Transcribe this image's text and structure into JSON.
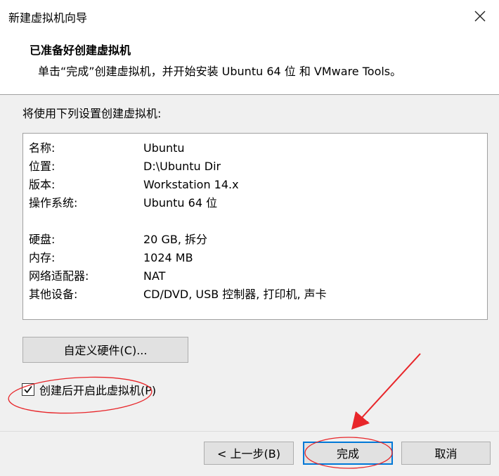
{
  "window": {
    "title": "新建虚拟机向导",
    "close_icon": "close-icon"
  },
  "header": {
    "title": "已准备好创建虚拟机",
    "subtitle": "单击“完成”创建虚拟机，并开始安装 Ubuntu 64 位 和 VMware Tools。"
  },
  "summary": {
    "intro": "将使用下列设置创建虚拟机:",
    "rows": [
      {
        "key": "名称:",
        "value": "Ubuntu"
      },
      {
        "key": "位置:",
        "value": "D:\\Ubuntu Dir"
      },
      {
        "key": "版本:",
        "value": "Workstation 14.x"
      },
      {
        "key": "操作系统:",
        "value": "Ubuntu 64 位"
      },
      {
        "key": "硬盘:",
        "value": "20 GB, 拆分"
      },
      {
        "key": "内存:",
        "value": "1024 MB"
      },
      {
        "key": "网络适配器:",
        "value": "NAT"
      },
      {
        "key": "其他设备:",
        "value": "CD/DVD, USB 控制器, 打印机, 声卡"
      }
    ]
  },
  "customize_label": "自定义硬件(C)...",
  "power_on": {
    "label": "创建后开启此虚拟机(P)",
    "checked": true
  },
  "buttons": {
    "back": "< 上一步(B)",
    "finish": "完成",
    "cancel": "取消"
  },
  "annotation_color": "#e8262a"
}
